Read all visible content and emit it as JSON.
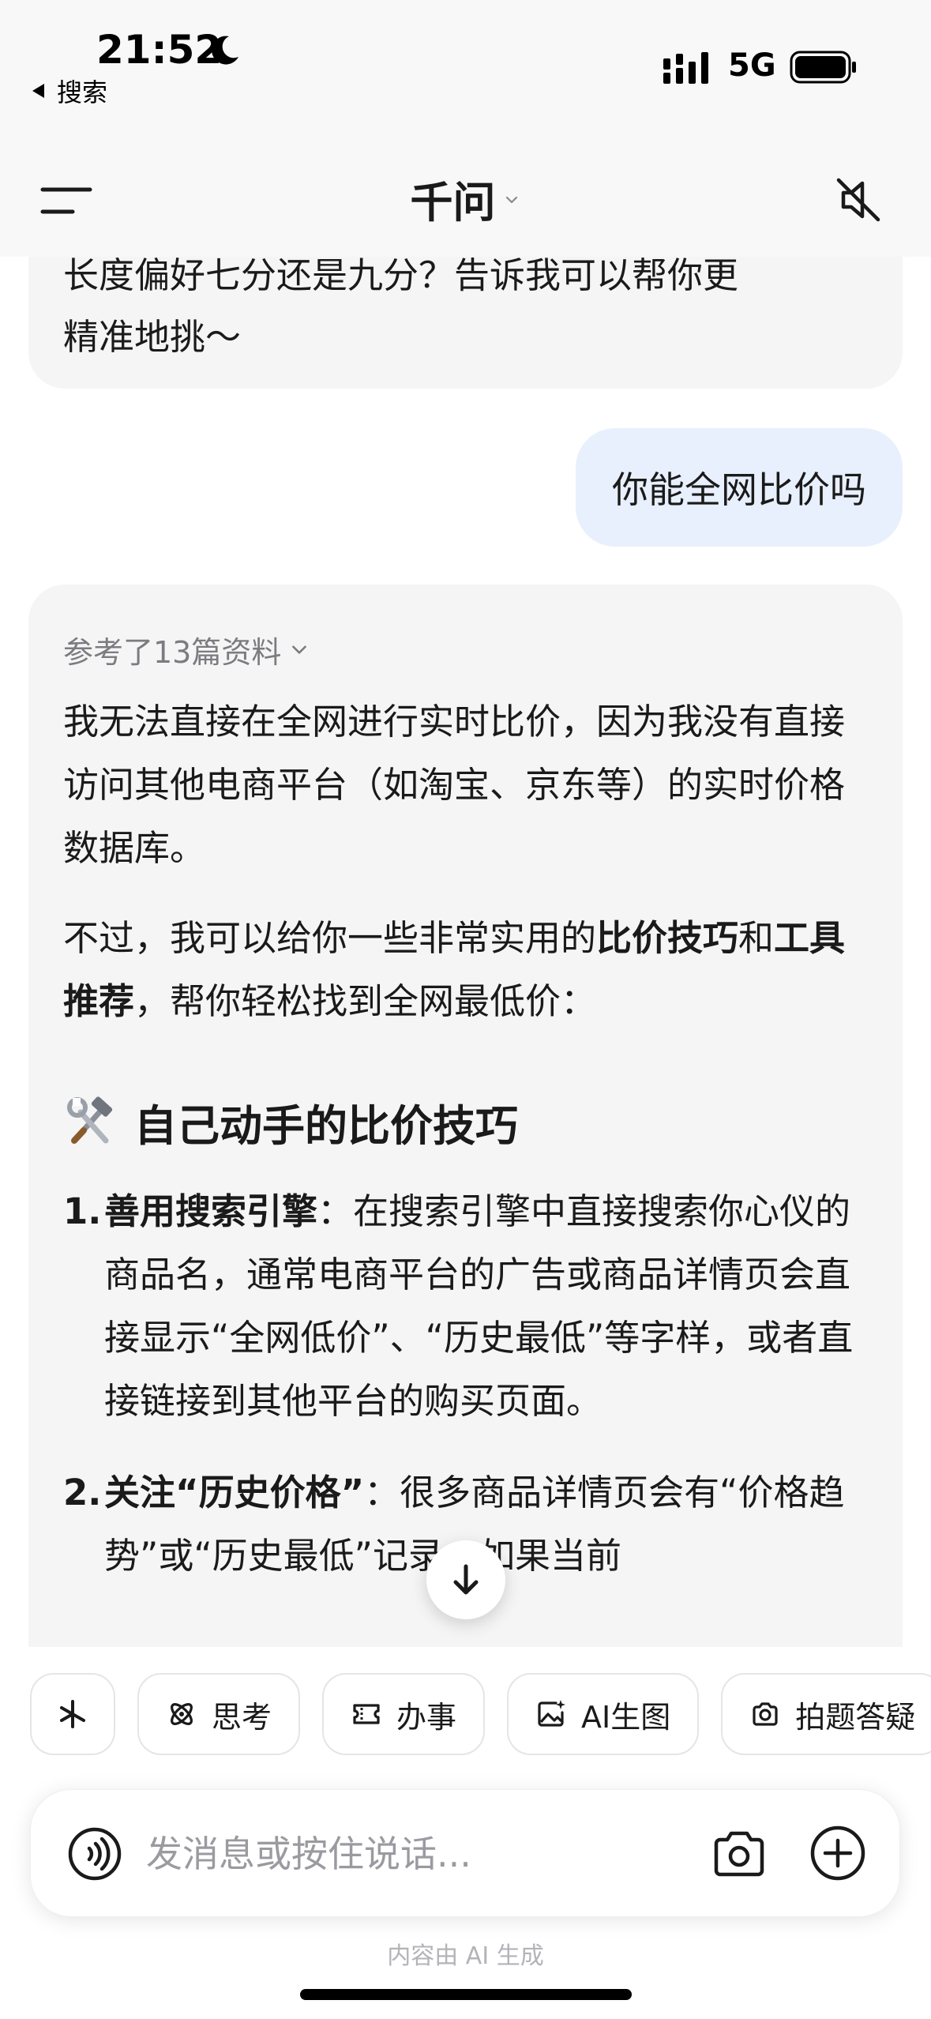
{
  "status_bar": {
    "time": "21:52",
    "back_label": "搜索",
    "network": "5G"
  },
  "header": {
    "title": "千问",
    "menu_icon": "menu-icon",
    "mute_icon": "speaker-muted-icon"
  },
  "messages": {
    "prev_ai": {
      "clipped_line": "长度偏好七分还是九分？告诉我可以帮你更",
      "last_line": "精准地挑～"
    },
    "user": {
      "text": "你能全网比价吗"
    },
    "ai": {
      "refs_label": "参考了13篇资料",
      "para1": "我无法直接在全网进行实时比价，因为我没有直接访问其他电商平台（如淘宝、京东等）的实时价格数据库。",
      "para2_prefix": "不过，我可以给你一些非常实用的",
      "para2_bold1": "比价技巧",
      "para2_mid": "和",
      "para2_bold2": "工具推荐",
      "para2_suffix": "，帮你轻松找到全网最低价：",
      "section_title": "自己动手的比价技巧",
      "section_icon": "hammer-wrench-icon",
      "list": [
        {
          "num": "1.",
          "title": "善用搜索引擎",
          "sep": "：",
          "body": "在搜索引擎中直接搜索你心仪的商品名，通常电商平台的广告或商品详情页会直接显示“全网低价”、“历史最低”等字样，或者直接链接到其他平台的购买页面。"
        },
        {
          "num": "2.",
          "title": "关注“历史价格”",
          "sep": "：",
          "body": "很多商品详情页会有“价格趋势”或“历史最低”记录，如果当前"
        }
      ]
    }
  },
  "scroll_down_icon": "arrow-down-icon",
  "chips": [
    {
      "label": "",
      "icon": "sparkle-icon"
    },
    {
      "label": "思考",
      "icon": "atom-icon"
    },
    {
      "label": "办事",
      "icon": "ticket-icon"
    },
    {
      "label": "AI生图",
      "icon": "image-sparkle-icon"
    },
    {
      "label": "拍题答疑",
      "icon": "camera-scan-icon"
    }
  ],
  "input": {
    "placeholder": "发消息或按住说话..."
  },
  "disclaimer": "内容由 AI 生成",
  "colors": {
    "user_bubble": "#e8f0fd",
    "ai_bubble": "#f5f5f6",
    "muted_text": "#7b7b80"
  }
}
